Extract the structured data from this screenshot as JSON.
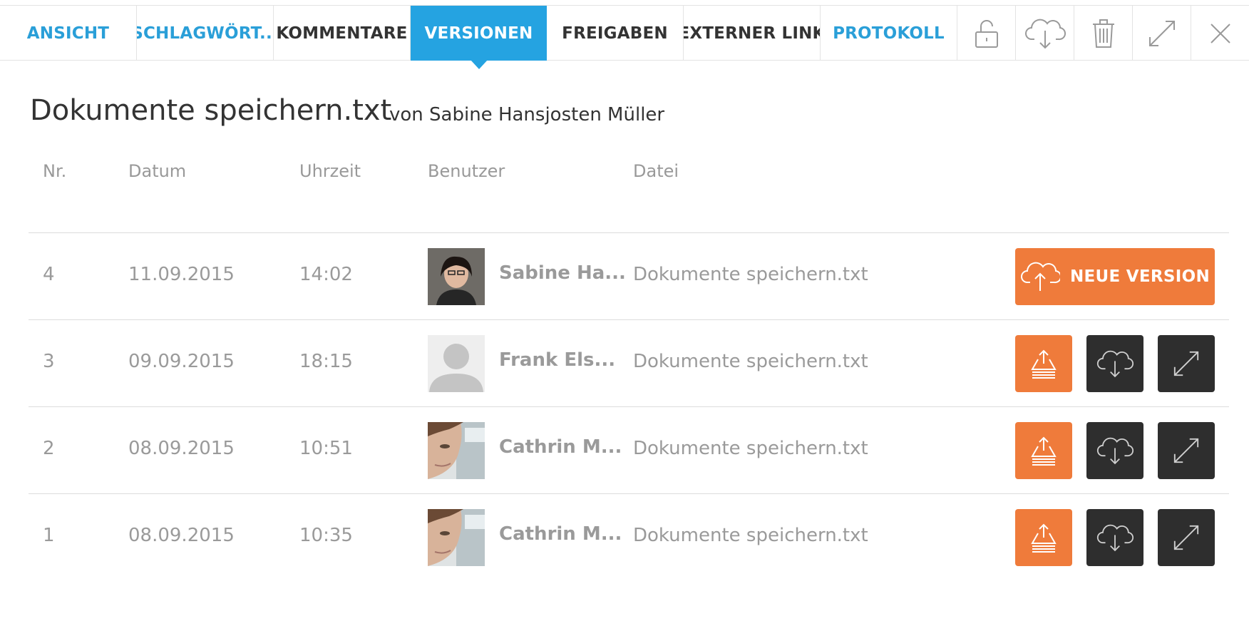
{
  "tabs": [
    {
      "label": "ANSICHT"
    },
    {
      "label": "SCHLAGWÖRT..."
    },
    {
      "label": "KOMMENTARE"
    },
    {
      "label": "VERSIONEN"
    },
    {
      "label": "FREIGABEN"
    },
    {
      "label": "EXTERNER LINK"
    },
    {
      "label": "PROTOKOLL"
    }
  ],
  "toolbar_icons": [
    "unlock-icon",
    "cloud-download-icon",
    "trash-icon",
    "expand-icon",
    "close-icon"
  ],
  "document": {
    "title": "Dokumente speichern.txt",
    "byline": "von Sabine Hansjosten Müller"
  },
  "columns": {
    "nr": "Nr.",
    "datum": "Datum",
    "uhrzeit": "Uhrzeit",
    "benutzer": "Benutzer",
    "datei": "Datei"
  },
  "versions": [
    {
      "nr": "4",
      "datum": "11.09.2015",
      "uhrzeit": "14:02",
      "benutzer": "Sabine Ha...",
      "datei": "Dokumente speichern.txt"
    },
    {
      "nr": "3",
      "datum": "09.09.2015",
      "uhrzeit": "18:15",
      "benutzer": "Frank Els...",
      "datei": "Dokumente speichern.txt"
    },
    {
      "nr": "2",
      "datum": "08.09.2015",
      "uhrzeit": "10:51",
      "benutzer": "Cathrin M...",
      "datei": "Dokumente speichern.txt"
    },
    {
      "nr": "1",
      "datum": "08.09.2015",
      "uhrzeit": "10:35",
      "benutzer": "Cathrin M...",
      "datei": "Dokumente speichern.txt"
    }
  ],
  "new_version_label": "NEUE VERSION",
  "colors": {
    "accent_blue": "#25a3e1",
    "action_orange": "#ef7b3b",
    "action_dark": "#2e2e2e"
  }
}
